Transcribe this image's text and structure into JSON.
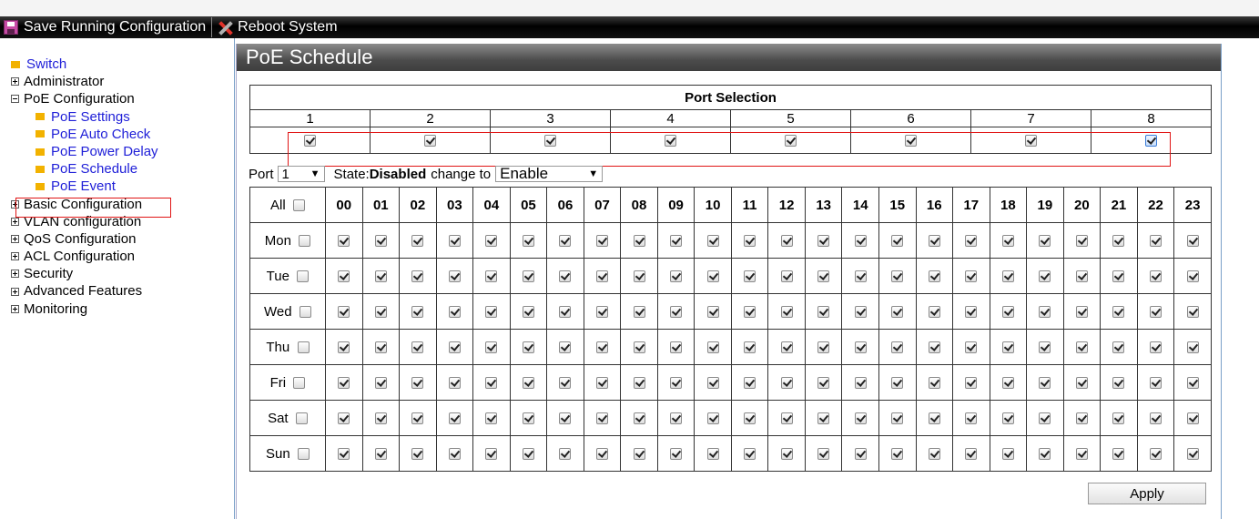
{
  "toolbar": {
    "save_label": "Save Running Configuration",
    "reboot_label": "Reboot System"
  },
  "sidebar": {
    "items": [
      {
        "label": "Switch",
        "type": "leaf"
      },
      {
        "label": "Administrator",
        "type": "plus"
      },
      {
        "label": "PoE Configuration",
        "type": "minus"
      },
      {
        "label": "PoE Settings",
        "type": "sub"
      },
      {
        "label": "PoE Auto Check",
        "type": "sub"
      },
      {
        "label": "PoE Power Delay",
        "type": "sub"
      },
      {
        "label": "PoE Schedule",
        "type": "sub",
        "selected": true
      },
      {
        "label": "PoE Event",
        "type": "sub"
      },
      {
        "label": "Basic Configuration",
        "type": "plus"
      },
      {
        "label": "VLAN configuration",
        "type": "plus"
      },
      {
        "label": "QoS Configuration",
        "type": "plus"
      },
      {
        "label": "ACL Configuration",
        "type": "plus"
      },
      {
        "label": "Security",
        "type": "plus"
      },
      {
        "label": "Advanced Features",
        "type": "plus"
      },
      {
        "label": "Monitoring",
        "type": "plus"
      }
    ]
  },
  "panel": {
    "title": "PoE Schedule"
  },
  "port_selection": {
    "header": "Port Selection",
    "ports": [
      "1",
      "2",
      "3",
      "4",
      "5",
      "6",
      "7",
      "8"
    ],
    "checked": [
      true,
      true,
      true,
      true,
      true,
      true,
      true,
      true
    ]
  },
  "controls": {
    "port_label": "Port",
    "port_value": "1",
    "state_prefix": "State:",
    "state_value": "Disabled",
    "change_label": "change to",
    "change_value": "Enable"
  },
  "schedule": {
    "all_label": "All",
    "hours": [
      "00",
      "01",
      "02",
      "03",
      "04",
      "05",
      "06",
      "07",
      "08",
      "09",
      "10",
      "11",
      "12",
      "13",
      "14",
      "15",
      "16",
      "17",
      "18",
      "19",
      "20",
      "21",
      "22",
      "23"
    ],
    "days": [
      "Mon",
      "Tue",
      "Wed",
      "Thu",
      "Fri",
      "Sat",
      "Sun"
    ]
  },
  "apply_label": "Apply"
}
